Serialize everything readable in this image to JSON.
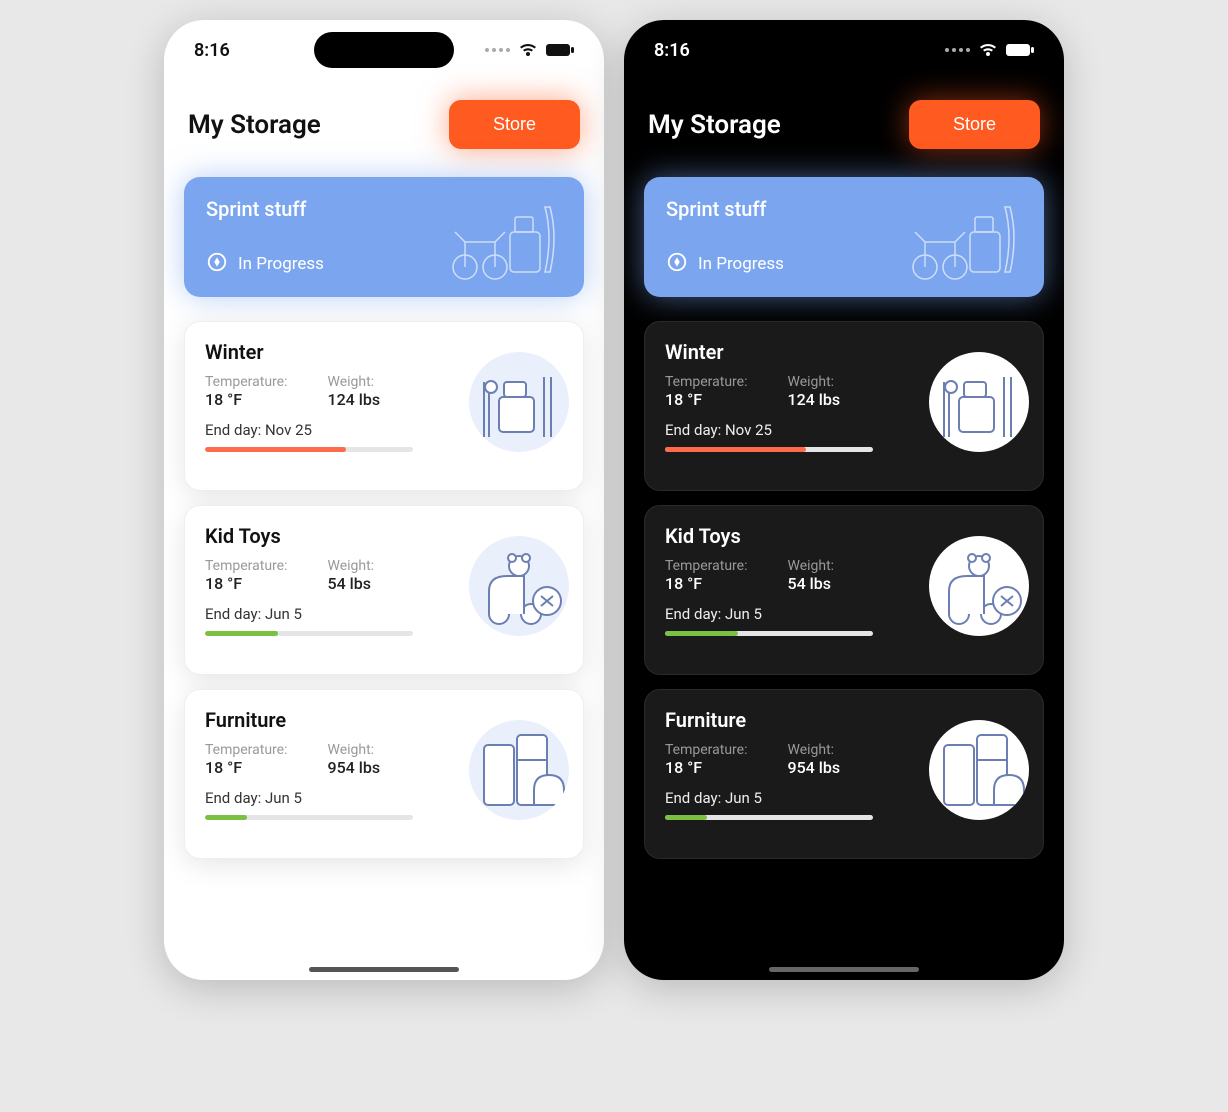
{
  "status_bar": {
    "time": "8:16"
  },
  "header": {
    "title": "My Storage",
    "store_label": "Store"
  },
  "banner": {
    "title": "Sprint stuff",
    "status": "In Progress"
  },
  "labels": {
    "temperature": "Temperature:",
    "weight": "Weight:",
    "end_day_prefix": "End day: "
  },
  "cards": [
    {
      "title": "Winter",
      "temperature": "18 °F",
      "weight": "124 lbs",
      "end_day": "Nov 25",
      "progress_pct": 68,
      "progress_color": "#ff6b4a"
    },
    {
      "title": "Kid Toys",
      "temperature": "18 °F",
      "weight": "54 lbs",
      "end_day": "Jun 5",
      "progress_pct": 35,
      "progress_color": "#7bc043"
    },
    {
      "title": "Furniture",
      "temperature": "18 °F",
      "weight": "954 lbs",
      "end_day": "Jun 5",
      "progress_pct": 20,
      "progress_color": "#7bc043"
    }
  ],
  "colors": {
    "accent": "#ff5a1f",
    "banner": "#7ba6ef"
  }
}
